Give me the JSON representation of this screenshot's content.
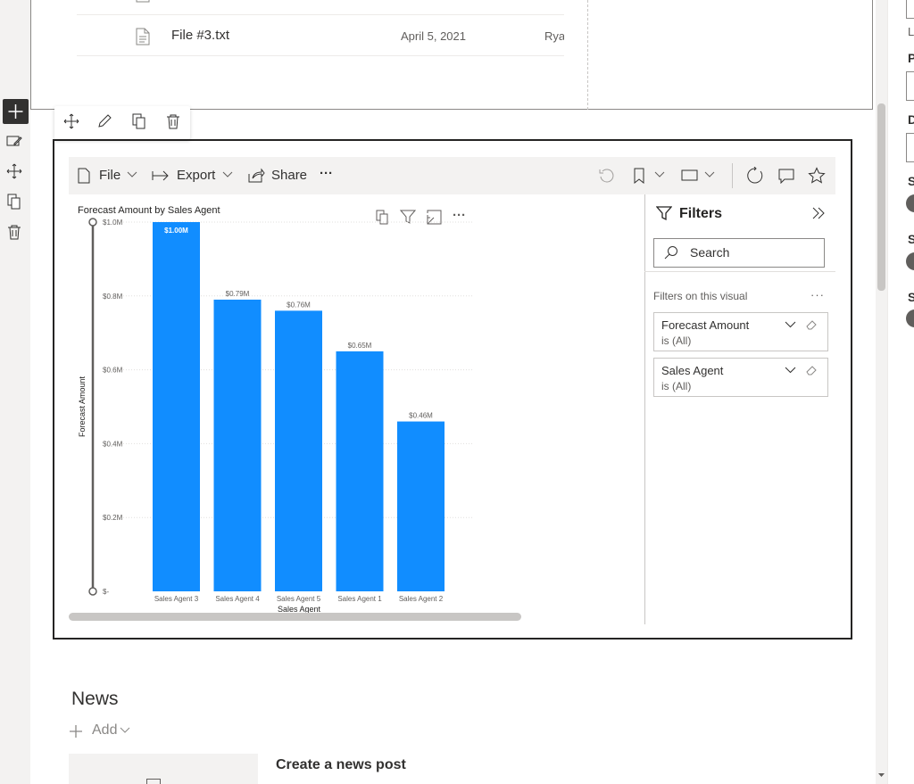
{
  "files": [
    {
      "name": "File #3.txt",
      "date": "April 5, 2021",
      "owner": "Ryan"
    }
  ],
  "powerbi": {
    "toolbar": {
      "file_label": "File",
      "export_label": "Export",
      "share_label": "Share",
      "more_label": "···"
    },
    "filters": {
      "title": "Filters",
      "search_placeholder": "Search",
      "section_label": "Filters on this visual",
      "more_label": "···",
      "cards": [
        {
          "name": "Forecast Amount",
          "state": "is (All)"
        },
        {
          "name": "Sales Agent",
          "state": "is (All)"
        }
      ]
    },
    "visual_more": "···"
  },
  "chart_data": {
    "type": "bar",
    "title": "Forecast Amount by Sales Agent",
    "xlabel": "Sales Agent",
    "ylabel": "Forecast Amount",
    "categories": [
      "Sales Agent 3",
      "Sales Agent 4",
      "Sales Agent 5",
      "Sales Agent 1",
      "Sales Agent 2"
    ],
    "values": [
      1.0,
      0.79,
      0.76,
      0.65,
      0.46
    ],
    "data_labels": [
      "$1.00M",
      "$0.79M",
      "$0.76M",
      "$0.65M",
      "$0.46M"
    ],
    "yticks": [
      0,
      0.2,
      0.4,
      0.6,
      0.8,
      1.0
    ],
    "ytick_labels": [
      "$-",
      "$0.2M",
      "$0.4M",
      "$0.6M",
      "$0.8M",
      "$1.0M"
    ],
    "ylim": [
      0,
      1.0
    ],
    "grid": true,
    "bar_color": "#118dff"
  },
  "news": {
    "title": "News",
    "add_label": "Add",
    "create_post": "Create a news post"
  },
  "right_panel": {
    "letters": [
      "P",
      "D",
      "S",
      "S",
      "S"
    ],
    "caption": "Le"
  },
  "colors": {
    "accent": "#118dff",
    "dark": "#323130"
  }
}
